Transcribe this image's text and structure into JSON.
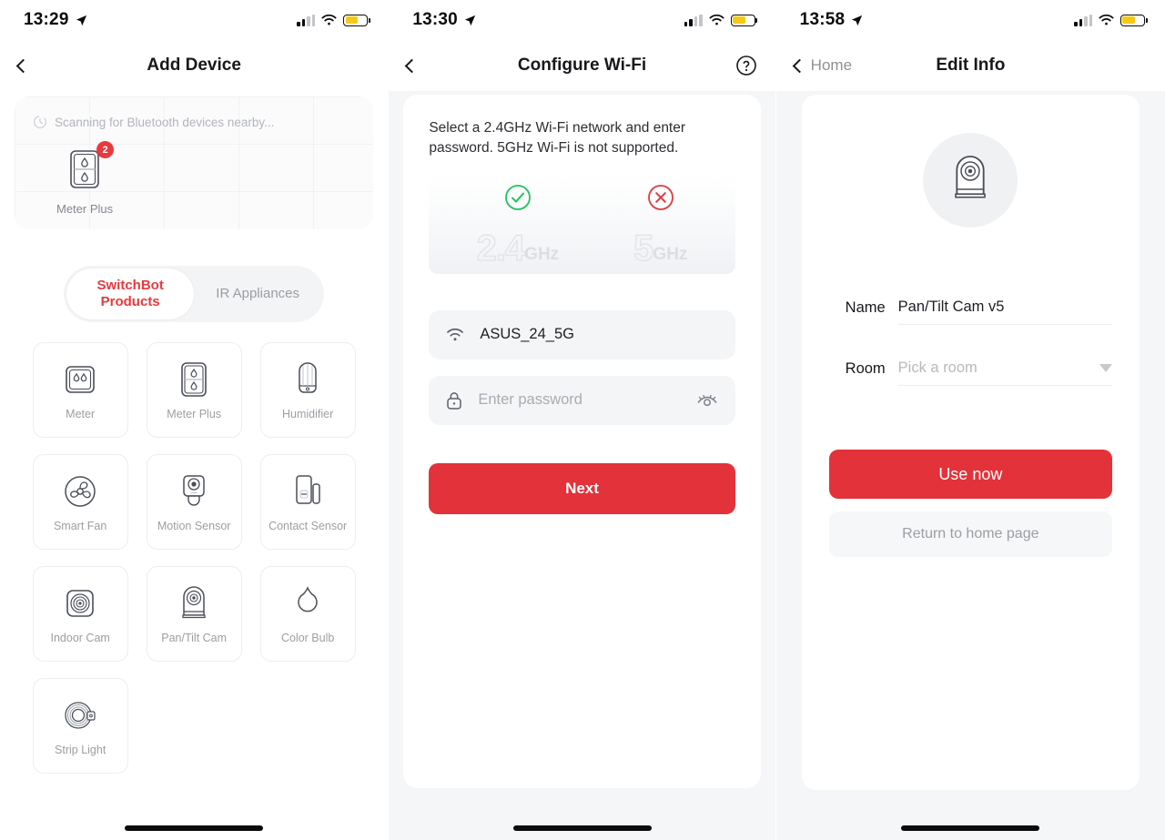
{
  "screen1": {
    "status": {
      "time": "13:29",
      "location_icon": "location-arrow-icon",
      "battery_icon": "battery-low-power-icon"
    },
    "nav": {
      "back_icon": "chevron-left-icon",
      "title": "Add Device"
    },
    "scanning": {
      "spinner_icon": "scanning-spinner-icon",
      "text": "Scanning for Bluetooth devices nearby...",
      "found": [
        {
          "name": "Meter Plus",
          "badge": "2",
          "icon": "meter-plus-icon"
        }
      ]
    },
    "tabs": [
      {
        "label": "SwitchBot Products",
        "active": true
      },
      {
        "label": "IR Appliances",
        "active": false
      }
    ],
    "products": [
      {
        "label": "Meter",
        "icon": "meter-icon"
      },
      {
        "label": "Meter Plus",
        "icon": "meter-plus-icon"
      },
      {
        "label": "Humidifier",
        "icon": "humidifier-icon"
      },
      {
        "label": "Smart Fan",
        "icon": "smart-fan-icon"
      },
      {
        "label": "Motion Sensor",
        "icon": "motion-sensor-icon"
      },
      {
        "label": "Contact Sensor",
        "icon": "contact-sensor-icon"
      },
      {
        "label": "Indoor Cam",
        "icon": "indoor-cam-icon"
      },
      {
        "label": "Pan/Tilt Cam",
        "icon": "pan-tilt-cam-icon"
      },
      {
        "label": "Color Bulb",
        "icon": "color-bulb-icon"
      },
      {
        "label": "Strip Light",
        "icon": "strip-light-icon"
      }
    ]
  },
  "screen2": {
    "status": {
      "time": "13:30"
    },
    "nav": {
      "back_icon": "chevron-left-icon",
      "title": "Configure Wi-Fi",
      "help_icon": "question-circle-icon"
    },
    "description": "Select a 2.4GHz Wi-Fi network and enter password. 5GHz Wi-Fi is not supported.",
    "bands": [
      {
        "num": "2.4",
        "unit": "GHz",
        "status": "supported",
        "status_icon": "check-circle-icon",
        "color": "#21c25e"
      },
      {
        "num": "5",
        "unit": "GHz",
        "status": "not-supported",
        "status_icon": "x-circle-icon",
        "color": "#e03a3f"
      }
    ],
    "ssid_field": {
      "icon": "wifi-icon",
      "value": "ASUS_24_5G"
    },
    "password_field": {
      "icon": "lock-icon",
      "placeholder": "Enter password",
      "value": "",
      "toggle_icon": "eye-hidden-icon"
    },
    "next_button": "Next"
  },
  "screen3": {
    "status": {
      "time": "13:58"
    },
    "nav": {
      "back_icon": "chevron-left-icon",
      "back_label": "Home",
      "title": "Edit Info"
    },
    "device_avatar_icon": "pan-tilt-cam-icon",
    "fields": [
      {
        "label": "Name",
        "value": "Pan/Tilt Cam v5",
        "placeholder": ""
      },
      {
        "label": "Room",
        "value": "",
        "placeholder": "Pick a room",
        "caret_icon": "chevron-down-icon"
      }
    ],
    "primary_button": "Use now",
    "secondary_button": "Return to home page"
  },
  "colors": {
    "accent": "#e33239",
    "badge": "#e8393c",
    "success": "#21c25e",
    "error": "#e03a3f",
    "battery": "#f6c915"
  }
}
